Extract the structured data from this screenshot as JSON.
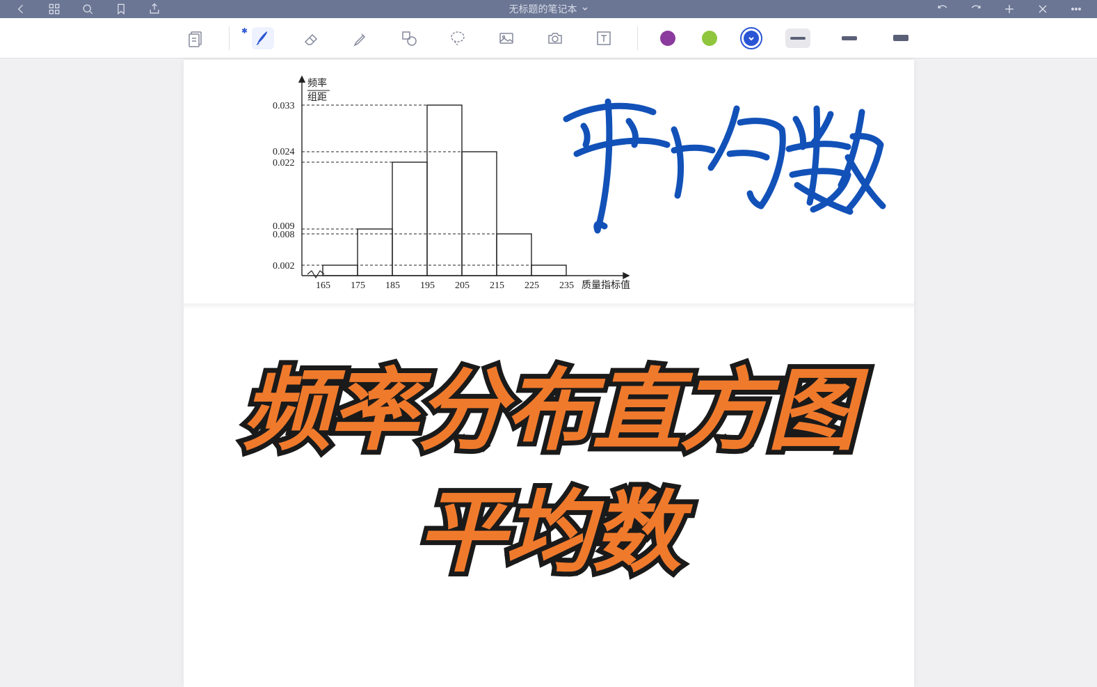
{
  "top_bar": {
    "title": "无标题的笔记本"
  },
  "toolbar": {
    "colors": {
      "purple": "#8b3a9e",
      "green": "#8fc63d",
      "blue": "#2a55d4",
      "selected_index": 2
    },
    "strokes": {
      "s1": 4,
      "s2": 6,
      "s3": 9,
      "selected_index": 0
    }
  },
  "handwriting_text": "平均数",
  "poster": {
    "line1": "频率分布直方图",
    "line2": "平均数"
  },
  "chart_data": {
    "type": "bar",
    "title": "",
    "xlabel": "质量指标值",
    "ylabel": "频率/组距",
    "categories": [
      "165",
      "175",
      "185",
      "195",
      "205",
      "215",
      "225",
      "235"
    ],
    "bar_edges": [
      165,
      175,
      185,
      195,
      205,
      215,
      225,
      235
    ],
    "values": [
      0.002,
      0.009,
      0.022,
      0.033,
      0.024,
      0.008,
      0.002
    ],
    "y_ticks": [
      0.002,
      0.008,
      0.009,
      0.022,
      0.024,
      0.033
    ],
    "ylim": [
      0,
      0.036
    ]
  }
}
